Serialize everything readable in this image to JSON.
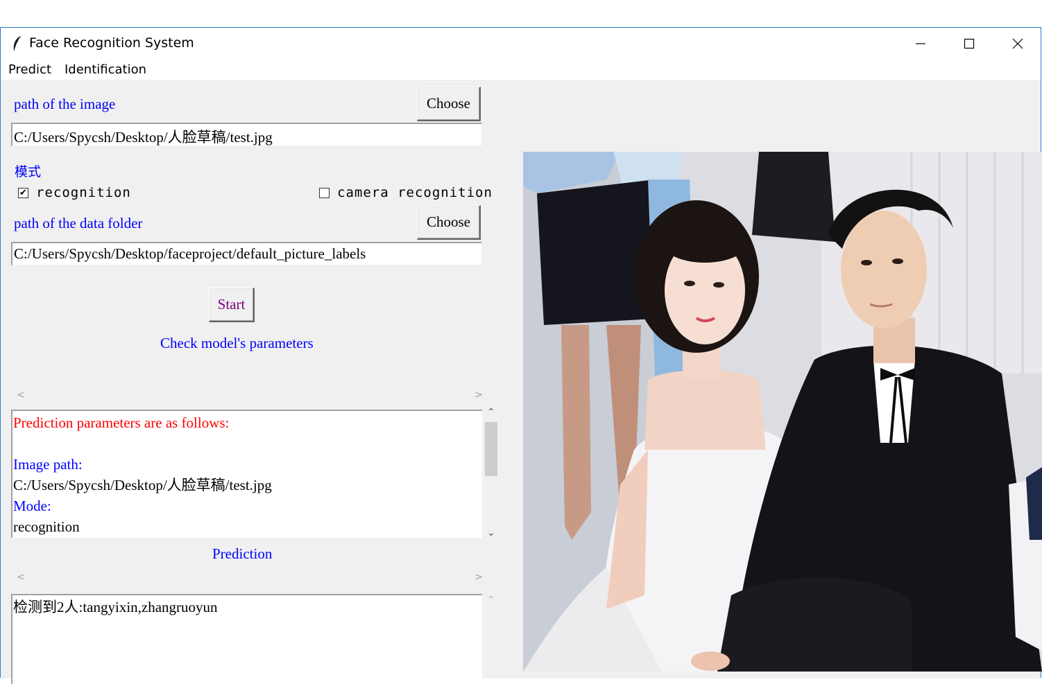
{
  "window": {
    "title": "Face Recognition System"
  },
  "menu": {
    "predict": "Predict",
    "identification": "Identification"
  },
  "form": {
    "image_path_label": "path of the image",
    "choose_label": "Choose",
    "image_path_value": "C:/Users/Spycsh/Desktop/人脸草稿/test.jpg",
    "mode_label": "模式",
    "mode_recognition": "recognition",
    "mode_recognition_checked": true,
    "mode_camera": "camera recognition",
    "mode_camera_checked": false,
    "data_folder_label": "path of the data folder",
    "data_folder_value": "C:/Users/Spycsh/Desktop/faceproject/default_picture_labels",
    "start_label": "Start",
    "check_params_label": "Check model's parameters"
  },
  "params_box": {
    "heading": "Prediction parameters are as follows:",
    "image_path_key": "Image path:",
    "image_path_value": "C:/Users/Spycsh/Desktop/人脸草稿/test.jpg",
    "mode_key": "Mode:",
    "mode_value": "recognition"
  },
  "prediction": {
    "label": "Prediction",
    "result": "检测到2人:tangyixin,zhangruoyun"
  },
  "colors": {
    "label_blue": "#0000ff",
    "heading_red": "#ff0000",
    "start_purple": "#800080",
    "window_bg": "#f0f0f0"
  },
  "icons": {
    "app": "feather-icon",
    "minimize": "minimize-icon",
    "maximize": "maximize-icon",
    "close": "close-icon"
  }
}
